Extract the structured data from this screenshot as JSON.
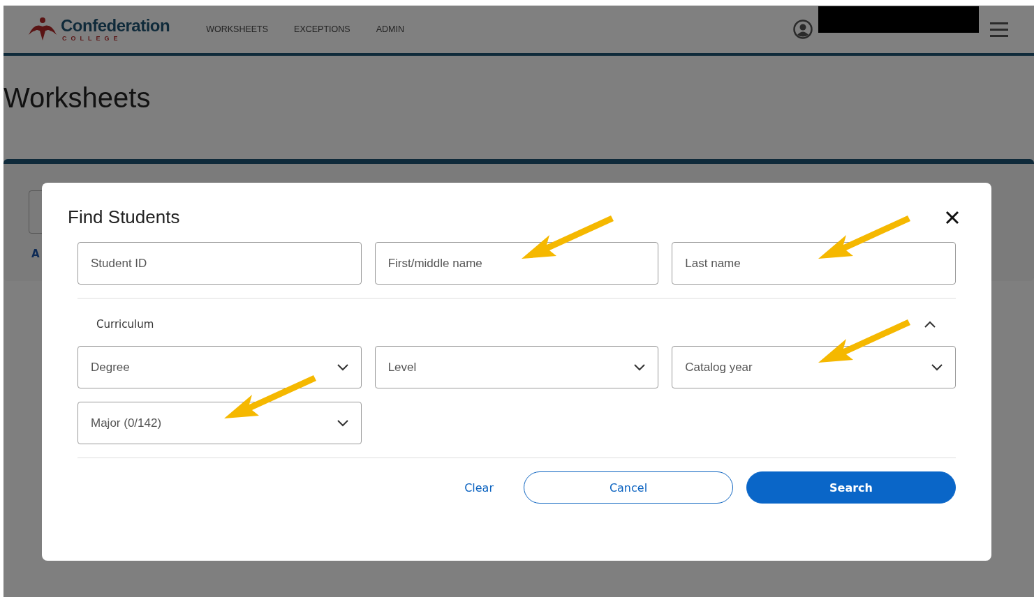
{
  "header": {
    "logo": {
      "name": "Confederation",
      "subtitle": "COLLEGE"
    },
    "nav": [
      {
        "label": "WORKSHEETS"
      },
      {
        "label": "EXCEPTIONS"
      },
      {
        "label": "ADMIN"
      }
    ]
  },
  "page": {
    "title": "Worksheets",
    "card_link": "A"
  },
  "dialog": {
    "title": "Find Students",
    "name_fields": [
      {
        "placeholder": "Student ID",
        "annotated": false
      },
      {
        "placeholder": "First/middle name",
        "annotated": true
      },
      {
        "placeholder": "Last name",
        "annotated": true
      }
    ],
    "section": {
      "label": "Curriculum",
      "expanded": true
    },
    "dropdowns": [
      {
        "placeholder": "Degree",
        "annotated": false
      },
      {
        "placeholder": "Level",
        "annotated": false
      },
      {
        "placeholder": "Catalog year",
        "annotated": true
      },
      {
        "placeholder": "Major (0/142)",
        "annotated": true
      }
    ],
    "buttons": [
      {
        "label": "Clear",
        "kind": "link"
      },
      {
        "label": "Cancel",
        "kind": "outline"
      },
      {
        "label": "Search",
        "kind": "primary"
      }
    ]
  }
}
